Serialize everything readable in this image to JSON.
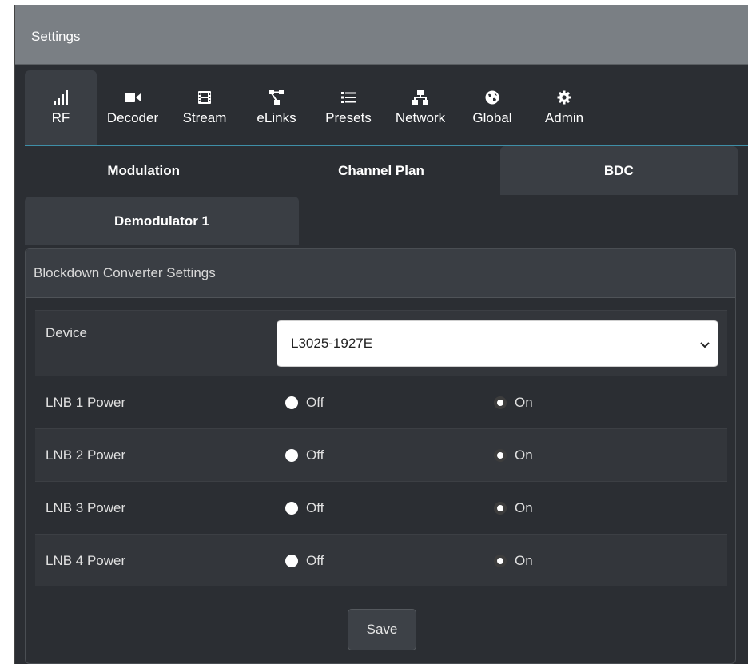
{
  "header": {
    "title": "Settings"
  },
  "main_tabs": [
    {
      "label": "RF",
      "icon": "signal-bars-icon",
      "active": true
    },
    {
      "label": "Decoder",
      "icon": "video-camera-icon"
    },
    {
      "label": "Stream",
      "icon": "film-icon"
    },
    {
      "label": "eLinks",
      "icon": "project-diagram-icon"
    },
    {
      "label": "Presets",
      "icon": "list-icon"
    },
    {
      "label": "Network",
      "icon": "network-icon"
    },
    {
      "label": "Global",
      "icon": "globe-icon"
    },
    {
      "label": "Admin",
      "icon": "gear-icon"
    }
  ],
  "sub_tabs": [
    {
      "label": "Modulation"
    },
    {
      "label": "Channel Plan"
    },
    {
      "label": "BDC",
      "active": true
    }
  ],
  "demod_tab": {
    "label": "Demodulator 1"
  },
  "section": {
    "title": "Blockdown Converter Settings",
    "device": {
      "label": "Device",
      "selected": "L3025-1927E"
    },
    "rows": [
      {
        "label": "LNB 1 Power",
        "off": "Off",
        "on": "On",
        "selected": "On"
      },
      {
        "label": "LNB 2 Power",
        "off": "Off",
        "on": "On",
        "selected": "On"
      },
      {
        "label": "LNB 3 Power",
        "off": "Off",
        "on": "On",
        "selected": "On"
      },
      {
        "label": "LNB 4 Power",
        "off": "Off",
        "on": "On",
        "selected": "On"
      }
    ],
    "save_label": "Save"
  },
  "colors": {
    "header_bg": "#7a7f84",
    "panel_bg": "#2b2e33",
    "tab_active": "#3a3e44",
    "accent_line": "#3f8fa8"
  }
}
